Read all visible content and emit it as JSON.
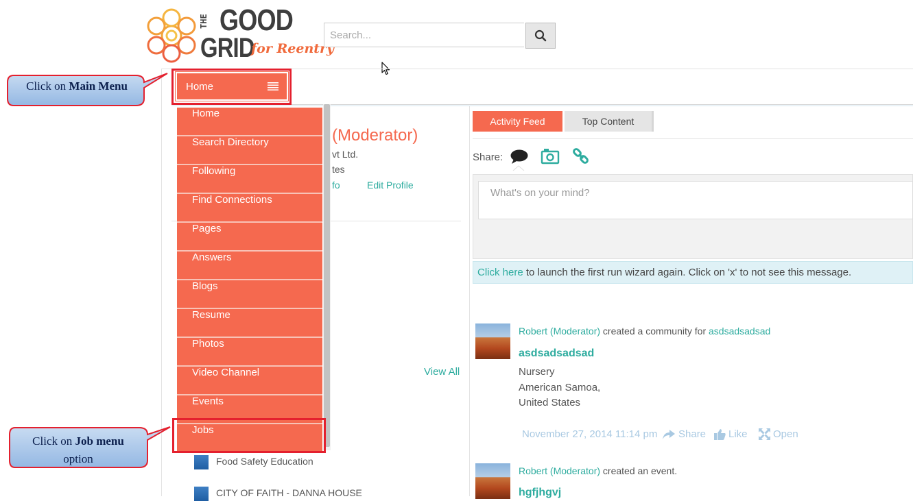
{
  "logo": {
    "line_the": "THE",
    "line1": "GOOD",
    "line2": "GRID",
    "tagline": "for Reentry"
  },
  "search": {
    "placeholder": "Search..."
  },
  "main_menu": {
    "current": "Home",
    "items": [
      "Home",
      "Search Directory",
      "Following",
      "Find Connections",
      "Pages",
      "Answers",
      "Blogs",
      "Resume",
      "Photos",
      "Video Channel",
      "Events",
      "Jobs"
    ]
  },
  "callouts": {
    "main_menu": {
      "prefix": "Click on ",
      "bold": "Main Menu"
    },
    "job_menu": {
      "prefix": "Click on ",
      "bold": "Job menu",
      "suffix": "option"
    }
  },
  "profile": {
    "name_suffix": "(Moderator)",
    "company_fragment": "vt Ltd.",
    "location_fragment": "tes",
    "info_fragment": "fo",
    "edit_profile": "Edit Profile",
    "view_all": "View All"
  },
  "sidebar_list": [
    {
      "label": "Food Safety Education"
    },
    {
      "label": "CITY OF FAITH - DANNA HOUSE"
    }
  ],
  "tabs": {
    "activity_feed": "Activity Feed",
    "top_content": "Top Content"
  },
  "share": {
    "label": "Share:",
    "icons": [
      "speech-bubble-icon",
      "camera-icon",
      "link-icon"
    ]
  },
  "composer": {
    "placeholder": "What's on your mind?"
  },
  "wizard": {
    "link": "Click here",
    "text": " to launch the first run wizard again. Click on 'x' to not see this message."
  },
  "feed": [
    {
      "author": "Robert (Moderator)",
      "action": " created a community for ",
      "target": "asdsadsadsad",
      "title": "asdsadsadsad",
      "details": [
        "Nursery",
        "American Samoa,",
        "United States"
      ],
      "timestamp": "November 27, 2014 11:14 pm",
      "actions": [
        "Share",
        "Like",
        "Open"
      ]
    },
    {
      "author": "Robert (Moderator)",
      "action": " created an event.",
      "title": "hgfjhgvj"
    }
  ],
  "colors": {
    "accent": "#f5694f",
    "teal": "#2eac9f",
    "highlight": "#e4202e",
    "callout_fill": "#a8c7ea"
  }
}
